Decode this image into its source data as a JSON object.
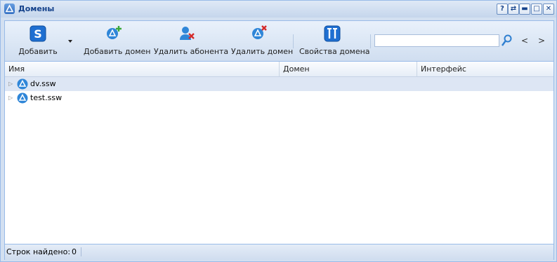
{
  "window": {
    "title": "Домены"
  },
  "title_tools": [
    {
      "name": "help-button",
      "glyph": "?"
    },
    {
      "name": "refresh-button",
      "glyph": "⇄"
    },
    {
      "name": "minimize-button",
      "glyph": "▬"
    },
    {
      "name": "maximize-button",
      "glyph": "□"
    },
    {
      "name": "close-button",
      "glyph": "✕"
    }
  ],
  "toolbar": {
    "add_label": "Добавить",
    "add_domain_label": "Добавить домен",
    "remove_subscriber_label": "Удалить абонента",
    "remove_domain_label": "Удалить домен",
    "domain_properties_label": "Свойства домена",
    "search_value": "",
    "prev_glyph": "<",
    "next_glyph": ">"
  },
  "grid": {
    "columns": [
      "Имя",
      "Домен",
      "Интерфейс"
    ],
    "rows": [
      {
        "name": "dv.ssw",
        "selected": true
      },
      {
        "name": "test.ssw",
        "selected": false
      }
    ]
  },
  "status": {
    "label": "Строк найдено:",
    "count": "0"
  },
  "colors": {
    "accent": "#15428b",
    "border": "#99bbe8",
    "selected_row": "#dde6f4"
  }
}
